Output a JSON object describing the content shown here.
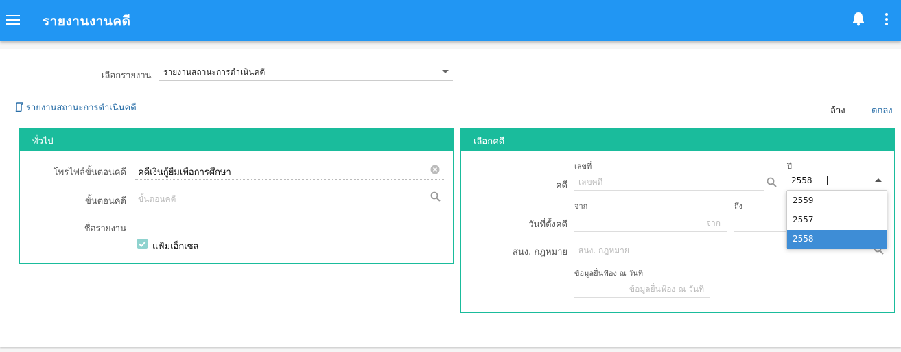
{
  "app": {
    "title": "รายงานงานคดี"
  },
  "header_icons": {
    "menu": "menu-icon",
    "notifications": "bell-icon",
    "more": "more-vert-icon"
  },
  "report_select": {
    "label": "เลือกรายงาน",
    "value": "รายงานสถานะการดำเนินคดี"
  },
  "section": {
    "title": "รายงานสถานะการดำเนินคดี",
    "clear_label": "ล้าง",
    "ok_label": "ตกลง"
  },
  "general_panel": {
    "title": "ทั่วไป",
    "profile_label": "โพรไฟล์ขั้นตอนคดี",
    "profile_value": "คดีเงินกู้ยืมเพื่อการศึกษา",
    "step_label": "ขั้นตอนคดี",
    "step_placeholder": "ขั้นตอนคดี",
    "report_name_label": "ชื่อรายงาน",
    "excel_label": "แฟ้มเอ็กเซล",
    "excel_checked": true
  },
  "case_panel": {
    "title": "เลือกคดี",
    "case_label": "คดี",
    "number_label": "เลขที่",
    "number_placeholder": "เลขคดี",
    "year_label": "ปี",
    "year_value": "2558",
    "year_options": [
      "2559",
      "2557",
      "2558"
    ],
    "year_selected": "2558",
    "filing_date_label": "วันที่ตั้งคดี",
    "from_label": "จาก",
    "from_placeholder": "จาก",
    "to_label": "ถึง",
    "legal_office_label": "สนง. กฎหมาย",
    "legal_office_placeholder": "สนง. กฎหมาย",
    "filing_info_label": "ข้อมูลยื่นฟ้อง ณ วันที่",
    "filing_info_placeholder": "ข้อมูลยื่นฟ้อง ณ วันที่"
  },
  "colors": {
    "primary": "#2196f3",
    "accent": "#1abc9c",
    "link": "#2a6fa8",
    "selected": "#3e8dd6"
  }
}
